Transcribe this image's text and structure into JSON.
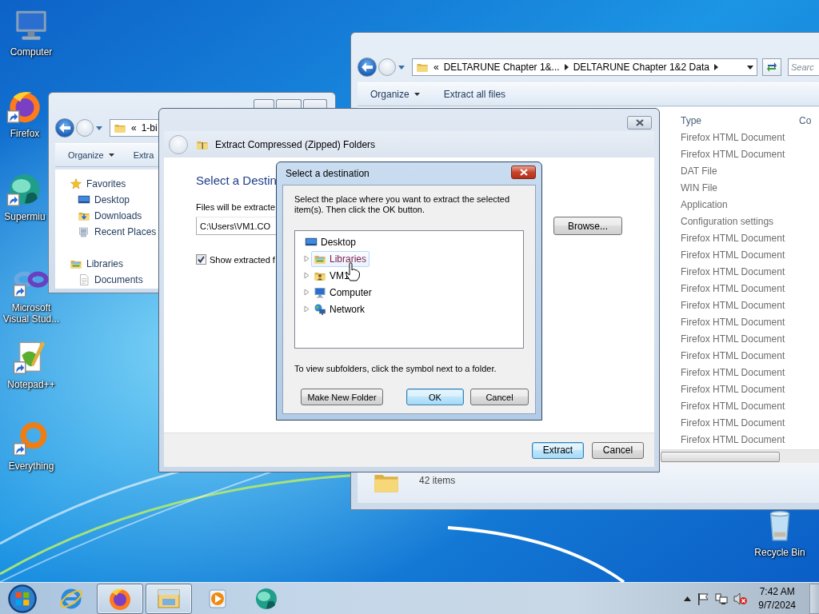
{
  "desktop_icons": [
    {
      "label": "Computer",
      "kind": "computer"
    },
    {
      "label": "Firefox",
      "kind": "firefox"
    },
    {
      "label": "Supermiu",
      "kind": "supermium"
    },
    {
      "label": "Microsoft Visual Stud...",
      "kind": "vs"
    },
    {
      "label": "Notepad++",
      "kind": "notepad"
    },
    {
      "label": "Everything",
      "kind": "everything"
    },
    {
      "label": "Recycle Bin",
      "kind": "recycle"
    }
  ],
  "explorer_right": {
    "address": {
      "overflow_mark": "«",
      "crumbs": [
        "DELTARUNE Chapter 1&...",
        "DELTARUNE Chapter 1&2 Data"
      ],
      "truncated": false
    },
    "search": {
      "placeholder": "Searc"
    },
    "commands": [
      {
        "label": "Organize",
        "menu": true
      },
      {
        "label": "Extract all files",
        "menu": false
      }
    ],
    "columns": [
      "Type",
      "Co"
    ],
    "type_cells": [
      "Firefox HTML Document",
      "Firefox HTML Document",
      "DAT File",
      "WIN File",
      "Application",
      "Configuration settings",
      "Firefox HTML Document",
      "Firefox HTML Document",
      "Firefox HTML Document",
      "Firefox HTML Document",
      "Firefox HTML Document",
      "Firefox HTML Document",
      "Firefox HTML Document",
      "Firefox HTML Document",
      "Firefox HTML Document",
      "Firefox HTML Document",
      "Firefox HTML Document",
      "Firefox HTML Document",
      "Firefox HTML Document"
    ],
    "status": "42 items"
  },
  "explorer_left": {
    "address": {
      "overflow_mark": "«",
      "crumbs": [
        "1-bi"
      ],
      "truncated": true
    },
    "commands": [
      {
        "label": "Organize",
        "menu": true
      },
      {
        "label": "Extra",
        "menu": false
      }
    ],
    "nav": [
      {
        "label": "Favorites",
        "kind": "favorites",
        "children": [
          {
            "label": "Desktop",
            "kind": "desktop"
          },
          {
            "label": "Downloads",
            "kind": "downloads"
          },
          {
            "label": "Recent Places",
            "kind": "recent"
          }
        ]
      },
      {
        "label": "Libraries",
        "kind": "libraries",
        "children": [
          {
            "label": "Documents",
            "kind": "documents"
          }
        ]
      }
    ]
  },
  "extract_dialog": {
    "title": "Extract Compressed (Zipped) Folders",
    "heading": "Select a Destin",
    "path_label": "Files will be extracte",
    "path": "C:\\Users\\VM1.CO",
    "browse": "Browse...",
    "show_files": {
      "label": "Show extracted f",
      "checked": true
    },
    "buttons": [
      {
        "label": "Extract",
        "default": true
      },
      {
        "label": "Cancel",
        "default": false
      }
    ]
  },
  "destination_dialog": {
    "title": "Select a destination",
    "instruction": "Select the place where you want to extract the selected item(s).  Then click the OK button.",
    "tree": {
      "label": "Desktop",
      "kind": "desktop",
      "children": [
        {
          "label": "Libraries",
          "kind": "libraries",
          "expanded": false,
          "highlighted": true
        },
        {
          "label": "VM1",
          "kind": "user",
          "expanded": false,
          "highlighted": false
        },
        {
          "label": "Computer",
          "kind": "computer",
          "expanded": false,
          "highlighted": false
        },
        {
          "label": "Network",
          "kind": "network",
          "expanded": false,
          "highlighted": false
        }
      ]
    },
    "hint": "To view subfolders, click the symbol next to a folder.",
    "buttons": [
      {
        "label": "Make New Folder",
        "default": false
      },
      {
        "label": "OK",
        "default": true
      },
      {
        "label": "Cancel",
        "default": false
      }
    ]
  },
  "taskbar": {
    "items": [
      {
        "kind": "ie",
        "open": false
      },
      {
        "kind": "firefox",
        "open": true
      },
      {
        "kind": "explorer",
        "open": true
      },
      {
        "kind": "media",
        "open": false
      },
      {
        "kind": "supermium",
        "open": false
      }
    ],
    "time": "7:42 AM",
    "date": "9/7/2024"
  }
}
